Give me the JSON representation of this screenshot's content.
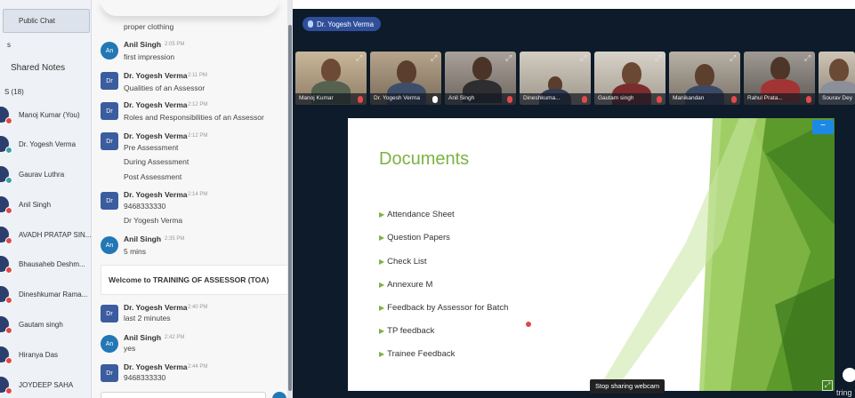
{
  "sidebar": {
    "public_chat_label": "Public Chat",
    "frag_s": "s",
    "shared_notes_label": "Shared Notes",
    "users_heading": "S (18)",
    "users": [
      {
        "name": "Manoj Kumar (You)"
      },
      {
        "name": "Dr. Yogesh Verma"
      },
      {
        "name": "Gaurav Luthra"
      },
      {
        "name": "Anil Singh"
      },
      {
        "name": "AVADH PRATAP SIN..."
      },
      {
        "name": "Bhausaheb Deshm..."
      },
      {
        "name": "Dineshkumar Rama..."
      },
      {
        "name": "Gautam singh"
      },
      {
        "name": "Hiranya Das"
      },
      {
        "name": "JOYDEEP SAHA"
      }
    ]
  },
  "chat": {
    "top_fragment": "proper clothing",
    "messages": [
      {
        "avatar": "An",
        "name": "Anil Singh",
        "time": "2:05 PM",
        "lines": [
          "first impression"
        ]
      },
      {
        "avatar": "Dr",
        "name": "Dr. Yogesh Verma",
        "time": "2:11 PM",
        "lines": [
          "Qualities of an Assessor"
        ]
      },
      {
        "avatar": "Dr",
        "name": "Dr. Yogesh Verma",
        "time": "2:12 PM",
        "lines": [
          "Roles and Responsibilities of an Assessor"
        ]
      },
      {
        "avatar": "Dr",
        "name": "Dr. Yogesh Verma",
        "time": "2:12 PM",
        "lines": [
          "Pre Assessment",
          "During Assessment",
          "Post Assessment"
        ]
      },
      {
        "avatar": "Dr",
        "name": "Dr. Yogesh Verma",
        "time": "2:14 PM",
        "lines": [
          "9468333330",
          "Dr Yogesh Verma"
        ]
      },
      {
        "avatar": "An",
        "name": "Anil Singh",
        "time": "2:35 PM",
        "lines": [
          "5 mins"
        ]
      },
      {
        "avatar": "Dr",
        "name": "Dr. Yogesh Verma",
        "time": "2:40 PM",
        "lines": [
          "last 2 minutes"
        ]
      },
      {
        "avatar": "An",
        "name": "Anil Singh",
        "time": "2:42 PM",
        "lines": [
          "yes"
        ]
      },
      {
        "avatar": "Dr",
        "name": "Dr. Yogesh Verma",
        "time": "2:44 PM",
        "lines": [
          "9468333330"
        ]
      }
    ],
    "welcome_text": "Welcome to TRAINING OF ASSESSOR (TOA)"
  },
  "conference": {
    "presenter_name": "Dr. Yogesh Verma",
    "tiles": [
      {
        "label": "Manoj Kumar"
      },
      {
        "label": "Dr. Yogesh Verma"
      },
      {
        "label": "Anil Singh"
      },
      {
        "label": "Dineshkuma..."
      },
      {
        "label": "Gautam singh"
      },
      {
        "label": "Manikandan"
      },
      {
        "label": "Rahul Prata..."
      },
      {
        "label": "Sourav Dey"
      }
    ],
    "slide": {
      "title": "Documents",
      "bullets": [
        "Attendance Sheet",
        "Question Papers",
        "Check List",
        "Annexure M",
        "Feedback by Assessor for Batch",
        "TP feedback",
        "Trainee Feedback"
      ]
    },
    "stop_webcam_label": "Stop sharing webcam",
    "brand_text": "tring"
  },
  "colors": {
    "accent_green": "#7cb342",
    "presenter_pill": "#2f4f9a",
    "chat_avatar_round": "#2277b5",
    "chat_avatar_square": "#3b5c9e",
    "mic_off_red": "#e34a4a"
  }
}
